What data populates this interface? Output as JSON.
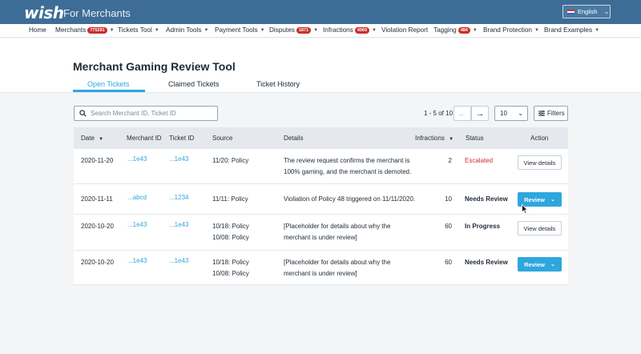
{
  "brand": {
    "logo": "wish",
    "subtitle": "For Merchants"
  },
  "language": {
    "label": "English"
  },
  "nav": {
    "items": [
      {
        "label": "Home",
        "badge": "",
        "caret": false
      },
      {
        "label": "Merchants",
        "badge": "775291",
        "caret": true
      },
      {
        "label": "Tickets Tool",
        "badge": "",
        "caret": true
      },
      {
        "label": "Admin Tools",
        "badge": "",
        "caret": true
      },
      {
        "label": "Payment Tools",
        "badge": "",
        "caret": true
      },
      {
        "label": "Disputes",
        "badge": "1871",
        "caret": true
      },
      {
        "label": "Infractions",
        "badge": "4069",
        "caret": true
      },
      {
        "label": "Violation Report",
        "badge": "",
        "caret": false
      },
      {
        "label": "Tagging",
        "badge": "484",
        "caret": true
      },
      {
        "label": "Brand Protection",
        "badge": "",
        "caret": true
      },
      {
        "label": "Brand Examples",
        "badge": "",
        "caret": true
      }
    ]
  },
  "page": {
    "title": "Merchant Gaming Review Tool",
    "tabs": [
      "Open Tickets",
      "Claimed Tickets",
      "Ticket History"
    ]
  },
  "toolbar": {
    "search_placeholder": "Search Merchant ID, Ticket ID",
    "pagination": "1 - 5 of 10",
    "page_size": "10",
    "filters_label": "Filters"
  },
  "table": {
    "headers": [
      "Date",
      "Merchant ID",
      "Ticket ID",
      "Source",
      "Details",
      "Infractions",
      "Status",
      "Action"
    ],
    "rows": [
      {
        "date": "2020-11-20",
        "merchant_id": "...1e43",
        "ticket_id": "...1e43",
        "source": [
          "11/20: Policy"
        ],
        "details": [
          "The review request confirms the merchant is",
          "100% gaming, and the merchant is demoted."
        ],
        "infractions": "2",
        "status": "Escalated",
        "action": "View details",
        "action_type": "view"
      },
      {
        "date": "2020-11-11",
        "merchant_id": "...abcd",
        "ticket_id": "...1234",
        "source": [
          "11/11: Policy"
        ],
        "details": [
          "Violiation of Policy 48 triggered on 11/11/2020."
        ],
        "infractions": "10",
        "status": "Needs Review",
        "action": "Review",
        "action_type": "review"
      },
      {
        "date": "2020-10-20",
        "merchant_id": "...1e43",
        "ticket_id": "...1e43",
        "source": [
          "10/18: Policy",
          "10/08: Policy"
        ],
        "details": [
          "[Placeholder for details about why the",
          "merchant is under review]"
        ],
        "infractions": "60",
        "status": "In Progress",
        "action": "View details",
        "action_type": "view"
      },
      {
        "date": "2020-10-20",
        "merchant_id": "...1e43",
        "ticket_id": "...1e43",
        "source": [
          "10/18: Policy",
          "10/08: Policy"
        ],
        "details": [
          "[Placeholder for details about why the",
          "merchant is under review]"
        ],
        "infractions": "60",
        "status": "Needs Review",
        "action": "Review",
        "action_type": "review"
      }
    ]
  },
  "colors": {
    "topbar": "#3d6d96",
    "accent": "#2fa6de",
    "danger": "#c9302c",
    "badge": "#c9302c"
  }
}
